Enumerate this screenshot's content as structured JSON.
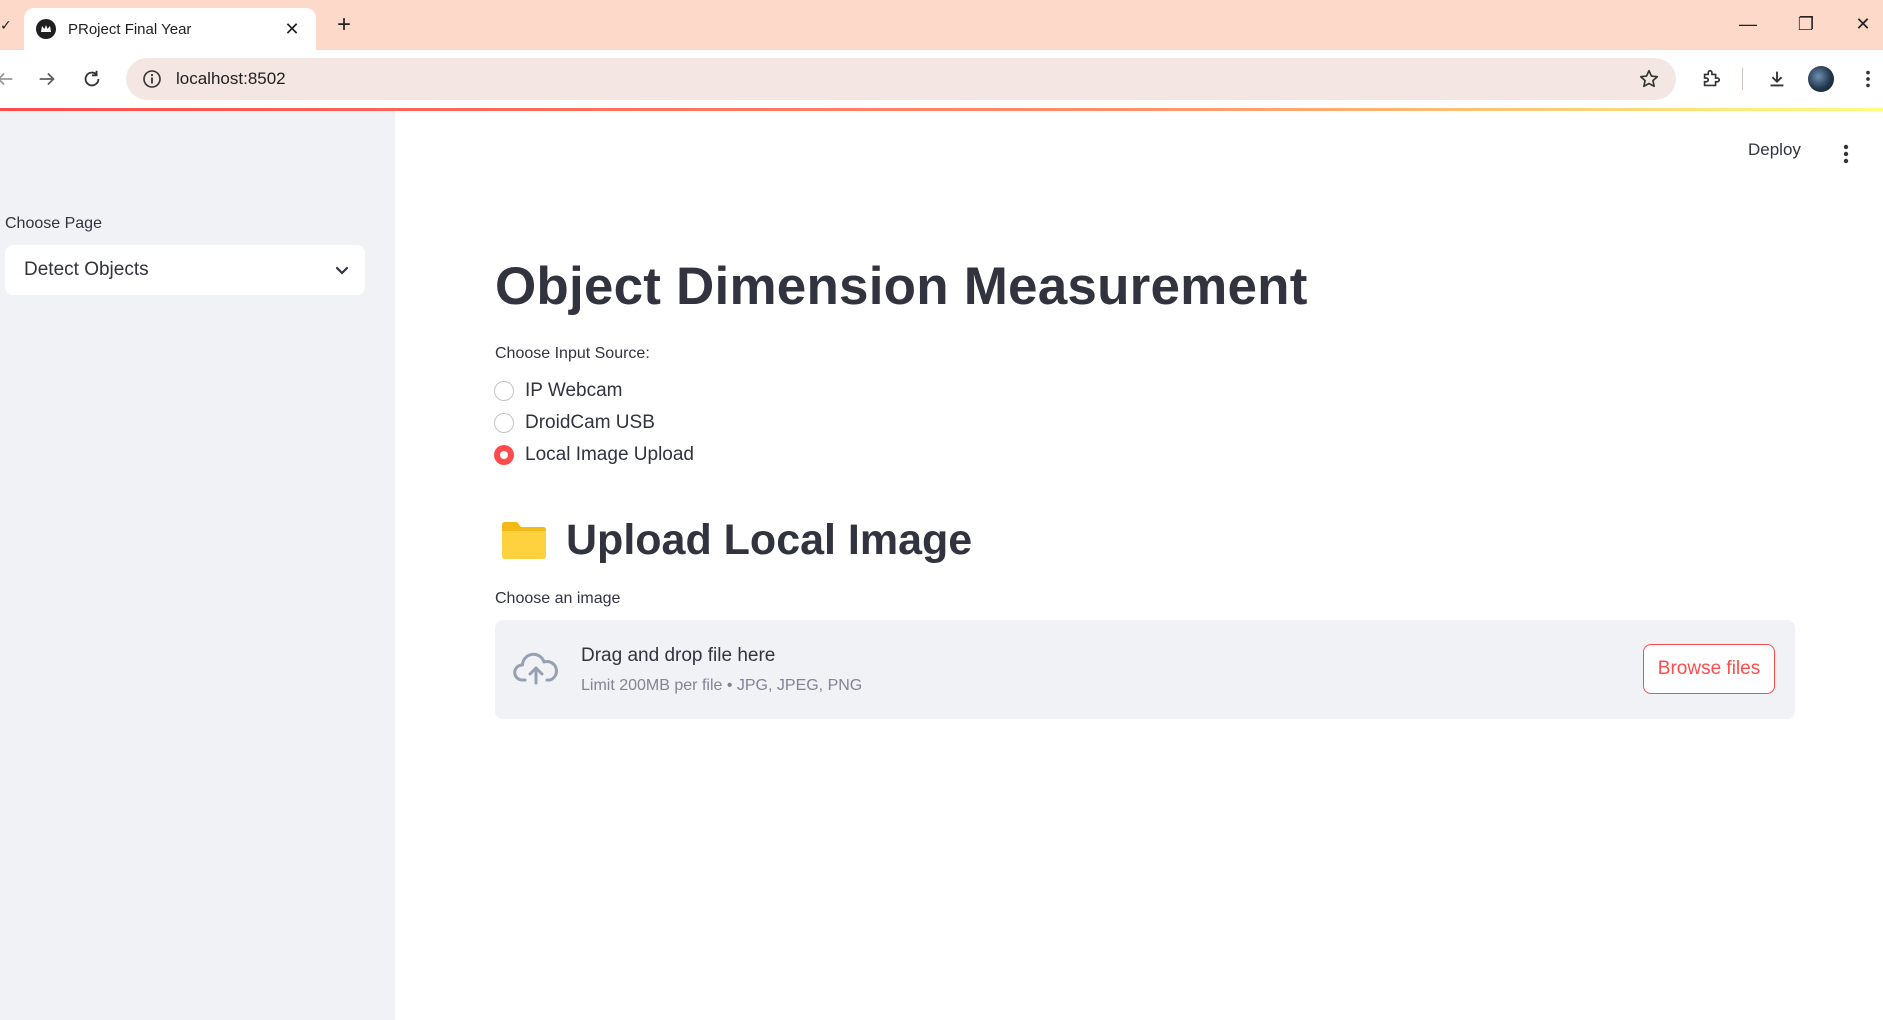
{
  "browser": {
    "tab_title": "PRoject Final Year",
    "tab_close": "✕",
    "new_tab": "+",
    "url": "localhost:8502",
    "window": {
      "minimize": "—",
      "restore": "❐",
      "close": "✕"
    }
  },
  "sidebar": {
    "select_label": "Choose Page",
    "select_value": "Detect Objects"
  },
  "header": {
    "deploy_label": "Deploy"
  },
  "main": {
    "title": "Object Dimension Measurement",
    "radio_label": "Choose Input Source:",
    "radio_options": [
      {
        "label": "IP Webcam",
        "checked": false
      },
      {
        "label": "DroidCam USB",
        "checked": false
      },
      {
        "label": "Local Image Upload",
        "checked": true
      }
    ],
    "upload_heading": "Upload Local Image",
    "upload_label": "Choose an image",
    "dropzone": {
      "title": "Drag and drop file here",
      "subtitle": "Limit 200MB per file • JPG, JPEG, PNG",
      "button": "Browse files"
    }
  },
  "colors": {
    "accent": "#ff4b4b",
    "sidebar_bg": "#f0f2f6",
    "text": "#31333f",
    "muted": "#808495",
    "tabbar_bg": "#fcd9c9"
  },
  "icons": [
    "back-arrow-icon",
    "forward-arrow-icon",
    "reload-icon",
    "site-info-icon",
    "bookmark-star-icon",
    "extensions-icon",
    "download-icon",
    "menu-icon",
    "chevron-down-icon",
    "kebab-icon",
    "folder-icon",
    "cloud-upload-icon"
  ]
}
